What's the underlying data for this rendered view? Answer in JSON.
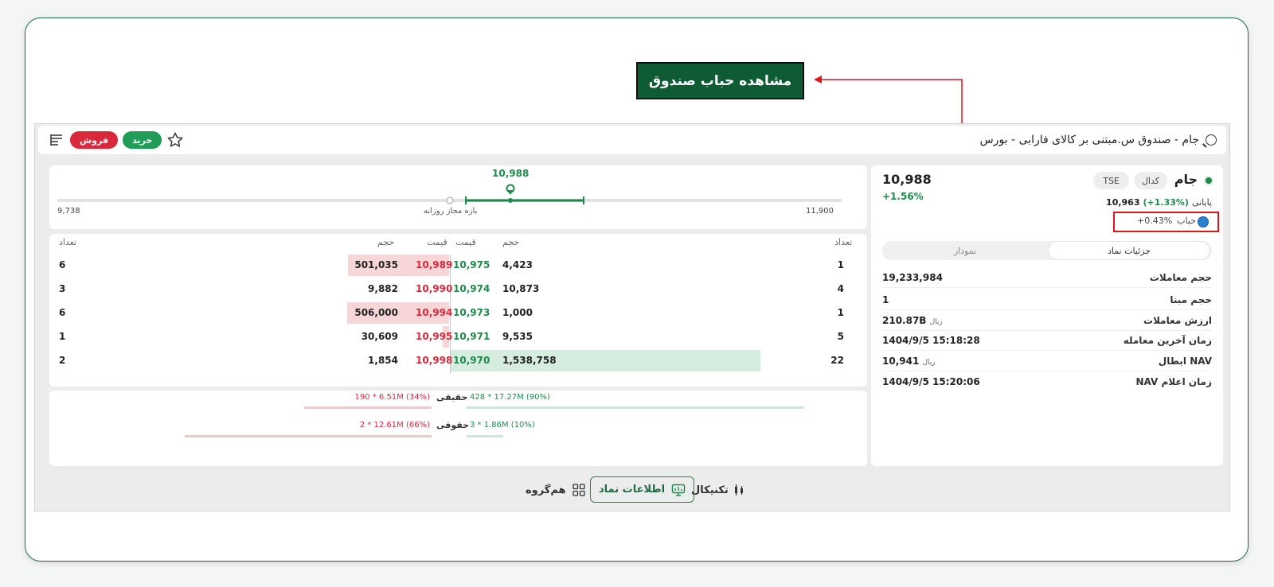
{
  "callout": {
    "label": "مشاهده حباب صندوق"
  },
  "topbar": {
    "search_text": "جام - صندوق س.مبتنی بر کالای فارابی - بورس",
    "sell_label": "فروش",
    "buy_label": "خرید"
  },
  "range": {
    "last_price": "10,988",
    "min_label": "9,738",
    "max_label": "11,900",
    "range_label": "بازه مجاز روزانه"
  },
  "orderbook": {
    "headers": {
      "count_left": "تعداد",
      "volume_left": "حجم",
      "price_sell": "قیمت",
      "price_buy": "قیمت",
      "volume_right": "حجم",
      "count_right": "تعداد"
    },
    "rows": [
      {
        "sell_count": "6",
        "sell_volume": "501,035",
        "sell_price": "10,989",
        "buy_price": "10,975",
        "buy_volume": "4,423",
        "buy_count": "1"
      },
      {
        "sell_count": "3",
        "sell_volume": "9,882",
        "sell_price": "10,990",
        "buy_price": "10,974",
        "buy_volume": "10,873",
        "buy_count": "4"
      },
      {
        "sell_count": "6",
        "sell_volume": "506,000",
        "sell_price": "10,994",
        "buy_price": "10,973",
        "buy_volume": "1,000",
        "buy_count": "1"
      },
      {
        "sell_count": "1",
        "sell_volume": "30,609",
        "sell_price": "10,995",
        "buy_price": "10,971",
        "buy_volume": "9,535",
        "buy_count": "5"
      },
      {
        "sell_count": "2",
        "sell_volume": "1,854",
        "sell_price": "10,998",
        "buy_price": "10,970",
        "buy_volume": "1,538,758",
        "buy_count": "22"
      }
    ]
  },
  "flow": {
    "real_label": "حقیقی",
    "legal_label": "حقوقی",
    "real_sell": "190 * 6.51M (34%)",
    "real_buy": "428 * 17.27M (90%)",
    "legal_sell": "2 * 12.61M (66%)",
    "legal_buy": "3 * 1.86M (10%)"
  },
  "info": {
    "symbol": "جام",
    "tag_kodal": "کدال",
    "tag_tse": "TSE",
    "price": "10,988",
    "change": "+1.56%",
    "closing_label": "پایانی",
    "closing_value": "10,963",
    "closing_change": "(+1.33%)",
    "bubble_label": "حباب",
    "bubble_value": "+0.43%",
    "tabs": {
      "details": "جزئیات نماد",
      "chart": "نمودار"
    },
    "rows": [
      {
        "label": "حجم معاملات",
        "value": "19,233,984",
        "unit": ""
      },
      {
        "label": "حجم مبنا",
        "value": "1",
        "unit": ""
      },
      {
        "label": "ارزش معاملات",
        "value": "210.87B",
        "unit": "ریال"
      },
      {
        "label": "زمان آخرین معامله",
        "value": "1404/9/5 15:18:28",
        "unit": ""
      },
      {
        "label": "NAV ابطال",
        "value": "10,941",
        "unit": "ریال"
      },
      {
        "label": "زمان اعلام NAV",
        "value": "1404/9/5 15:20:06",
        "unit": ""
      }
    ]
  },
  "bottom": {
    "technical": "تکنیکال",
    "symbol_info": "اطلاعات نماد",
    "peer_group": "هم‌گروه"
  },
  "colors": {
    "brand_green": "#0f5b34",
    "buy_green": "#1f9d57",
    "sell_red": "#d8283a",
    "highlight_red": "#e1141e"
  }
}
